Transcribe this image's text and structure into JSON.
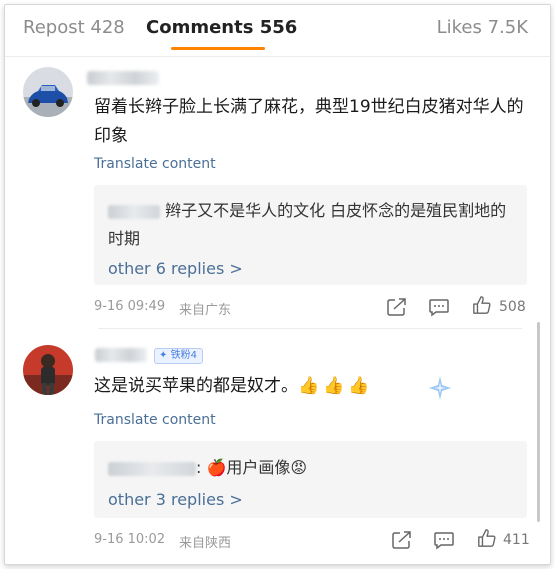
{
  "tabs": {
    "repost": "Repost 428",
    "comments": "Comments 556",
    "likes": "Likes 7.5K"
  },
  "comments": [
    {
      "text": "留着长辫子脸上长满了麻花，典型19世纪白皮猪对华人的印象",
      "translate_label": "Translate content",
      "reply": {
        "text": "辫子又不是华人的文化 白皮怀念的是殖民割地的时期",
        "more_label": "other 6 replies >"
      },
      "date": "9-16 09:49",
      "location": "来自广东",
      "likes": "508"
    },
    {
      "badge": "铁粉4",
      "text": "这是说买苹果的都是奴才。",
      "emoji": "👍👍👍",
      "translate_label": "Translate content",
      "reply": {
        "text": "用户画像",
        "more_label": "other 3 replies >"
      },
      "date": "9-16 10:02",
      "location": "来自陕西",
      "likes": "411"
    }
  ],
  "colors": {
    "accent": "#ff8200",
    "link": "#4a6f96"
  }
}
